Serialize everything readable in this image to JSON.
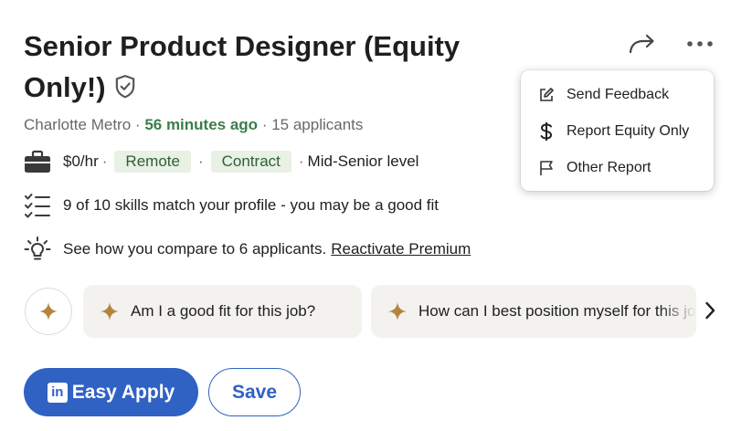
{
  "job": {
    "title": "Senior Product Designer (Equity Only!)",
    "location": "Charlotte Metro",
    "posted": "56 minutes ago",
    "applicants": "15 applicants",
    "pay": "$0/hr",
    "workplace": "Remote",
    "type": "Contract",
    "level": "Mid-Senior level",
    "skills_text": "9 of 10 skills match your profile - you may be a good fit",
    "compare_text": "See how you compare to 6 applicants.",
    "premium_link": "Reactivate Premium"
  },
  "menu": {
    "items": [
      {
        "label": "Send Feedback",
        "icon": "edit-icon"
      },
      {
        "label": "Report Equity Only",
        "icon": "dollar-icon"
      },
      {
        "label": "Other Report",
        "icon": "flag-icon"
      }
    ]
  },
  "ai_prompts": [
    "Am I a good fit for this job?",
    "How can I best position myself for this job?"
  ],
  "actions": {
    "easy_apply": "Easy Apply",
    "save": "Save",
    "linkedin_logo": "in"
  },
  "separators": {
    "dot": "·"
  },
  "colors": {
    "brand_blue": "#2f62c3",
    "accent_green": "#3c7d4a",
    "pill_bg": "#e8f1e4",
    "spark_gold": "#b5843c"
  }
}
